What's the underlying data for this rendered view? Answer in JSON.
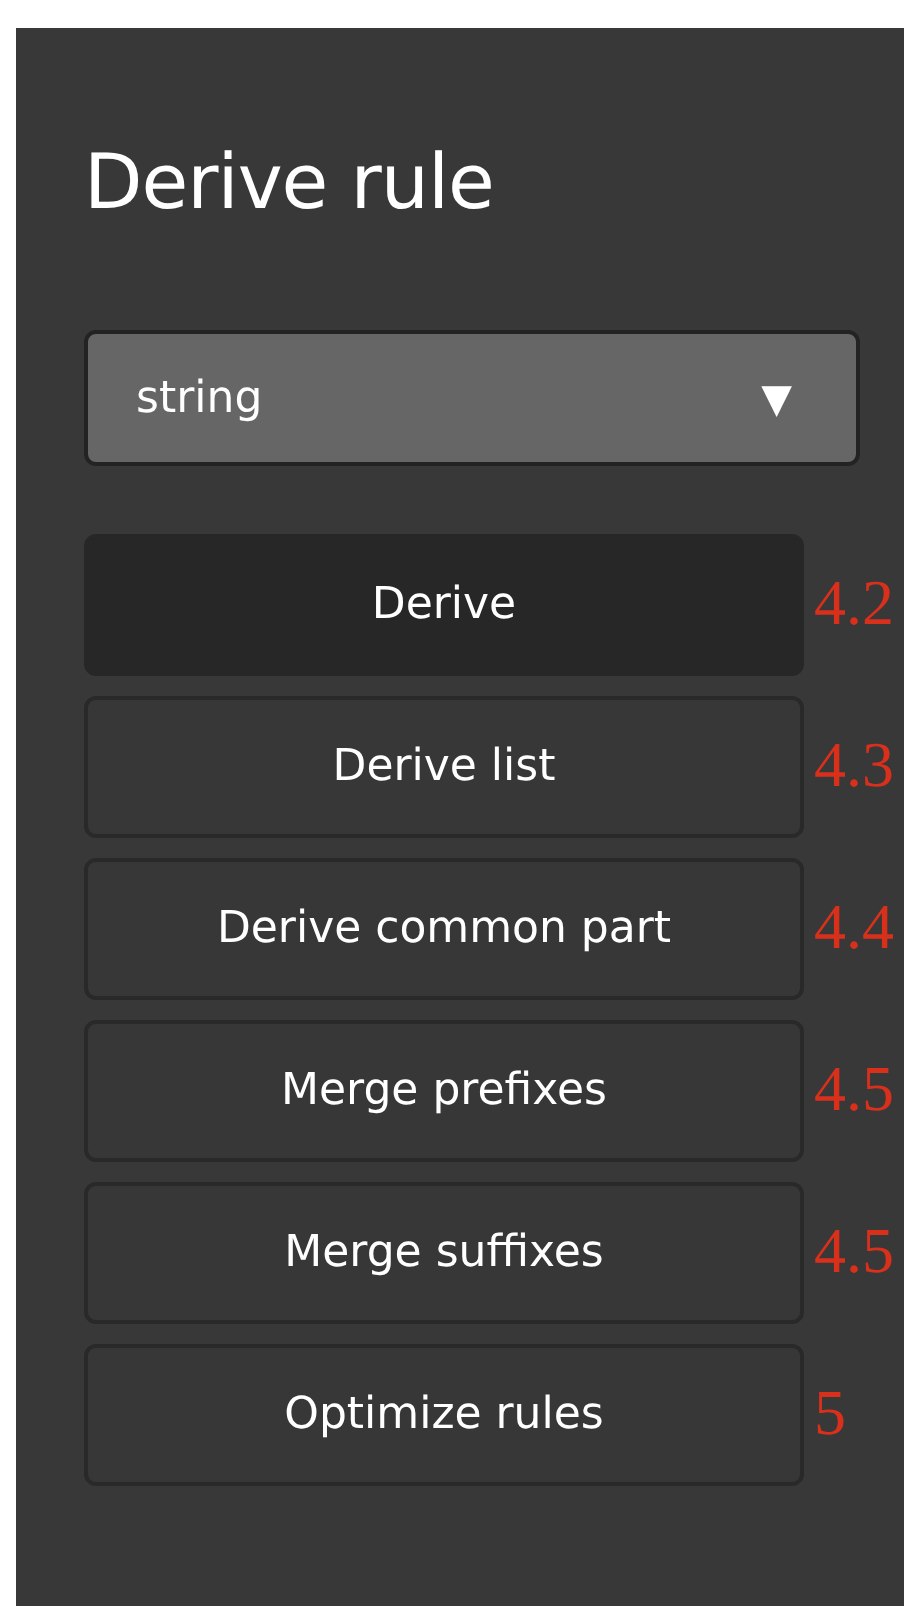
{
  "title": "Derive rule",
  "dropdown": {
    "value": "string",
    "caret": "▼"
  },
  "buttons": [
    {
      "label": "Derive",
      "selected": true,
      "note": "4.2"
    },
    {
      "label": "Derive list",
      "selected": false,
      "note": "4.3"
    },
    {
      "label": "Derive common part",
      "selected": false,
      "note": "4.4"
    },
    {
      "label": "Merge prefixes",
      "selected": false,
      "note": "4.5"
    },
    {
      "label": "Merge suffixes",
      "selected": false,
      "note": "4.5"
    },
    {
      "label": "Optimize rules",
      "selected": false,
      "note": "5"
    }
  ]
}
